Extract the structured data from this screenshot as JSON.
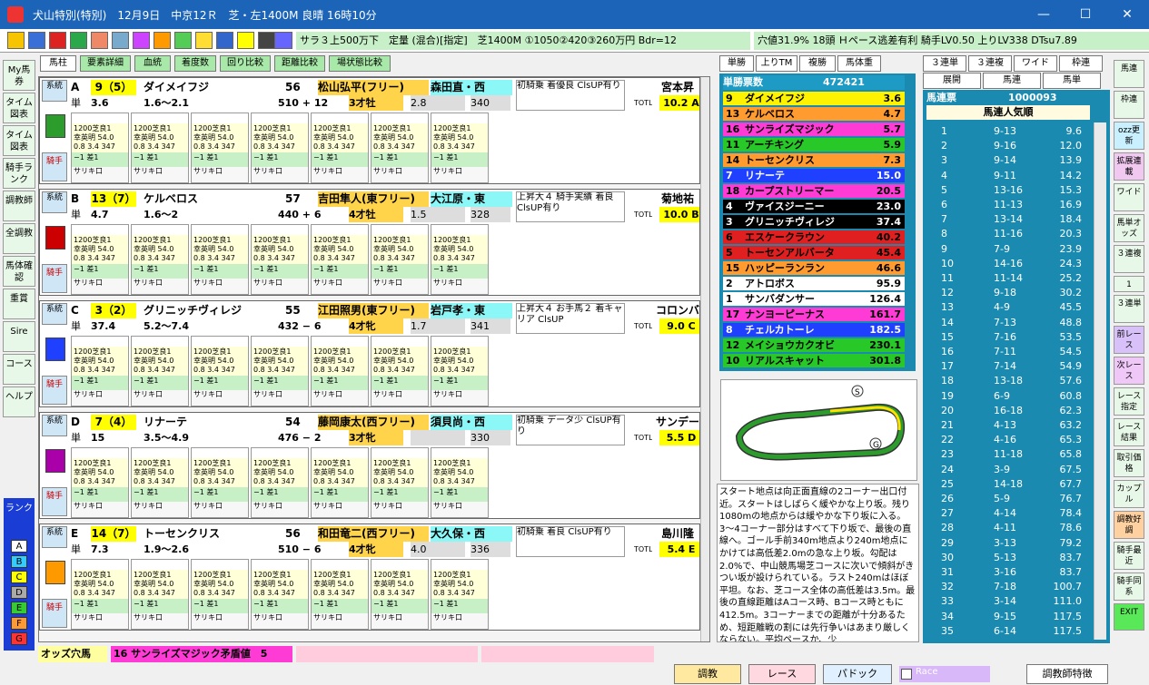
{
  "window": {
    "title": "犬山特別(特別)　12月9日　中京12Ｒ　芝・左1400M 良晴 16時10分",
    "minimize": "—",
    "maximize": "☐",
    "close": "✕"
  },
  "toolbar": {
    "race_info": "サラ３上500万下　定量 (混合)[指定]　芝1400M ①1050②420③260万円 Bdr=12",
    "race_info2": "穴値31.9% 18頭 Ｈペース逃差有利 騎手LV0.50 上りLV338 DTsu7.89"
  },
  "leftnav": [
    "My馬券",
    "タイム図表",
    "タイム図表",
    "騎手ランク",
    "調教師",
    "全調教",
    "馬体確認",
    "重賞",
    "Sire",
    "コース",
    "ヘルプ"
  ],
  "rank": {
    "title": "ランク",
    "levels": [
      "A",
      "B",
      "C",
      "D",
      "E",
      "F",
      "G"
    ]
  },
  "tabs": [
    "馬柱",
    "要素詳細",
    "血統",
    "着度数",
    "回り比較",
    "距離比較",
    "場状態比較"
  ],
  "horses": [
    {
      "tag": "A",
      "num": "9（5）",
      "name": "ダイメイフジ",
      "wt": "56",
      "jockey": "松山弘平(フリー)",
      "trainer": "森田直・西",
      "comment": "初騎乗 着優良 ClsUP有り",
      "owner": "宮本昇",
      "odds": "3.6",
      "oddsrange": "1.6〜2.1",
      "bw": "510 + 12",
      "age": "3才牡",
      "pos": "2.8",
      "agari": "340",
      "totl": "10.2 A",
      "sel": "系統",
      "btm": "騎手"
    },
    {
      "tag": "B",
      "num": "13（7）",
      "name": "ケルベロス",
      "wt": "57",
      "jockey": "吉田隼人(東フリー)",
      "trainer": "大江原・東",
      "comment": "上昇大４ 騎手実績 着良ClsUP有り",
      "owner": "菊地祐",
      "odds": "4.7",
      "oddsrange": "1.6〜2",
      "bw": "440 + 6",
      "age": "4才牡",
      "pos": "1.5",
      "agari": "328",
      "totl": "10.0 B",
      "sel": "系統",
      "btm": "騎手"
    },
    {
      "tag": "C",
      "num": "3（2）",
      "name": "グリニッチヴィレジ",
      "wt": "55",
      "jockey": "江田照男(東フリー)",
      "trainer": "岩戸孝・東",
      "comment": "上昇大４ お手馬２ 着キャリア ClsUP",
      "owner": "コロンバ",
      "odds": "37.4",
      "oddsrange": "5.2〜7.4",
      "bw": "432 − 6",
      "age": "4才牝",
      "pos": "1.7",
      "agari": "341",
      "totl": "9.0 C",
      "sel": "系統",
      "btm": "騎手"
    },
    {
      "tag": "D",
      "num": "7（4）",
      "name": "リナーテ",
      "wt": "54",
      "jockey": "藤岡康太(西フリー)",
      "trainer": "須貝尚・西",
      "comment": "初騎乗 データ少 ClsUP有り",
      "owner": "サンデー",
      "odds": "15",
      "oddsrange": "3.5〜4.9",
      "bw": "476 − 2",
      "age": "3才牝",
      "pos": "",
      "agari": "330",
      "totl": "5.5 D",
      "sel": "系統",
      "btm": "騎手"
    },
    {
      "tag": "E",
      "num": "14（7）",
      "name": "トーセンクリス",
      "wt": "56",
      "jockey": "和田竜二(西フリー)",
      "trainer": "大久保・西",
      "comment": "初騎乗 着良 ClsUP有り",
      "owner": "島川隆",
      "odds": "7.3",
      "oddsrange": "1.9〜2.6",
      "bw": "510 − 6",
      "age": "4才牝",
      "pos": "4.0",
      "agari": "336",
      "totl": "5.4 E",
      "sel": "系統",
      "btm": "騎手"
    }
  ],
  "past": {
    "race": "1200芝良1",
    "jockey": "幸英明 54.0",
    "stats": "0.8 3.4 347",
    "res": "−1 差1",
    "horse": "サリキ口",
    "time": "518 1:10:4"
  },
  "oddsbar": {
    "label": "オッズ穴馬",
    "value": "16 サンライズマジック矛盾値　5"
  },
  "tan": {
    "tabs": [
      "単勝",
      "上りTM",
      "複勝",
      "馬体重"
    ],
    "header": "単勝票数",
    "votes": "472421",
    "rows": [
      {
        "n": "9",
        "name": "ダイメイフジ",
        "o": "3.6",
        "bg": "#fff200",
        "fg": "#000"
      },
      {
        "n": "13",
        "name": "ケルベロス",
        "o": "4.7",
        "bg": "#ff9b2f",
        "fg": "#000"
      },
      {
        "n": "16",
        "name": "サンライズマジック",
        "o": "5.7",
        "bg": "#ff3bd6",
        "fg": "#000"
      },
      {
        "n": "11",
        "name": "アーチキング",
        "o": "5.9",
        "bg": "#28c828",
        "fg": "#000"
      },
      {
        "n": "14",
        "name": "トーセンクリス",
        "o": "7.3",
        "bg": "#ff9b2f",
        "fg": "#000"
      },
      {
        "n": "7",
        "name": "リナーテ",
        "o": "15.0",
        "bg": "#2040ff",
        "fg": "#fff"
      },
      {
        "n": "18",
        "name": "カープストリーマー",
        "o": "20.5",
        "bg": "#ff3bd6",
        "fg": "#000"
      },
      {
        "n": "4",
        "name": "ヴァイスジーニー",
        "o": "23.0",
        "bg": "#000",
        "fg": "#fff"
      },
      {
        "n": "3",
        "name": "グリニッチヴィレジ",
        "o": "37.4",
        "bg": "#000",
        "fg": "#fff"
      },
      {
        "n": "6",
        "name": "エスケークラウン",
        "o": "40.2",
        "bg": "#e02020",
        "fg": "#000"
      },
      {
        "n": "5",
        "name": "トーセンアルバータ",
        "o": "45.4",
        "bg": "#e02020",
        "fg": "#000"
      },
      {
        "n": "15",
        "name": "ハッピーランラン",
        "o": "46.6",
        "bg": "#ff9b2f",
        "fg": "#000"
      },
      {
        "n": "2",
        "name": "アトロボス",
        "o": "95.9",
        "bg": "#fff",
        "fg": "#000"
      },
      {
        "n": "1",
        "name": "サンバダンサー",
        "o": "126.4",
        "bg": "#fff",
        "fg": "#000"
      },
      {
        "n": "17",
        "name": "ナンヨーピーナス",
        "o": "161.7",
        "bg": "#ff3bd6",
        "fg": "#000"
      },
      {
        "n": "8",
        "name": "チェルカトーレ",
        "o": "182.5",
        "bg": "#2040ff",
        "fg": "#fff"
      },
      {
        "n": "12",
        "name": "メイショウカクオビ",
        "o": "230.1",
        "bg": "#28c828",
        "fg": "#000"
      },
      {
        "n": "10",
        "name": "リアルスキャット",
        "o": "301.8",
        "bg": "#28c828",
        "fg": "#000"
      }
    ]
  },
  "desc": "スタート地点は向正面直線の2コーナー出口付近。スタートはしばらく緩やかな上り坂。残り1080mの地点からは緩やかな下り坂に入る。3〜4コーナー部分はすべて下り坂で、最後の直線へ。ゴール手前340m地点より240m地点にかけては高低差2.0mの急な上り坂。勾配は2.0%で、中山競馬場芝コースに次いで傾斜がきつい坂が設けられている。ラスト240mはほぼ平坦。なお、芝コース全体の高低差は3.5m。最後の直線距離はAコース時、Bコース時ともに412.5m。3コーナーまでの距離が十分あるため、短距離戦の割には先行争いはあまり厳しくならない。平均ペースか、少",
  "rtabs": [
    "３連単",
    "３連複",
    "ワイド",
    "枠連",
    "展開",
    "馬連",
    "馬単"
  ],
  "baren": {
    "title": "馬連票",
    "votes": "1000093",
    "sub": "馬連人気順",
    "rows": [
      [
        "1",
        "9-13",
        "9.6"
      ],
      [
        "2",
        "9-16",
        "12.0"
      ],
      [
        "3",
        "9-14",
        "13.9"
      ],
      [
        "4",
        "9-11",
        "14.2"
      ],
      [
        "5",
        "13-16",
        "15.3"
      ],
      [
        "6",
        "11-13",
        "16.9"
      ],
      [
        "7",
        "13-14",
        "18.4"
      ],
      [
        "8",
        "11-16",
        "20.3"
      ],
      [
        "9",
        "7-9",
        "23.9"
      ],
      [
        "10",
        "14-16",
        "24.3"
      ],
      [
        "11",
        "11-14",
        "25.2"
      ],
      [
        "12",
        "9-18",
        "30.2"
      ],
      [
        "13",
        "4-9",
        "45.5"
      ],
      [
        "14",
        "7-13",
        "48.8"
      ],
      [
        "15",
        "7-16",
        "53.5"
      ],
      [
        "16",
        "7-11",
        "54.5"
      ],
      [
        "17",
        "7-14",
        "54.9"
      ],
      [
        "18",
        "13-18",
        "57.6"
      ],
      [
        "19",
        "6-9",
        "60.8"
      ],
      [
        "20",
        "16-18",
        "62.3"
      ],
      [
        "21",
        "4-13",
        "63.2"
      ],
      [
        "22",
        "4-16",
        "65.3"
      ],
      [
        "23",
        "11-18",
        "65.8"
      ],
      [
        "24",
        "3-9",
        "67.5"
      ],
      [
        "25",
        "14-18",
        "67.7"
      ],
      [
        "26",
        "5-9",
        "76.7"
      ],
      [
        "27",
        "4-14",
        "78.4"
      ],
      [
        "28",
        "4-11",
        "78.6"
      ],
      [
        "29",
        "3-13",
        "79.2"
      ],
      [
        "30",
        "5-13",
        "83.7"
      ],
      [
        "31",
        "3-16",
        "83.7"
      ],
      [
        "32",
        "7-18",
        "100.7"
      ],
      [
        "33",
        "3-14",
        "111.0"
      ],
      [
        "34",
        "9-15",
        "117.5"
      ],
      [
        "35",
        "6-14",
        "117.5"
      ]
    ]
  },
  "farnav": [
    "馬連",
    "枠連",
    "ozz更新",
    "拡展連載",
    "ワイド",
    "馬単オッズ",
    "３連複",
    "1",
    "３連単",
    "前レース",
    "次レース",
    "レース指定",
    "レース結果",
    "取引価格",
    "カップル",
    "調教好調",
    "騎手最近",
    "騎手同系",
    "EXIT"
  ],
  "bottom": {
    "b1": "調教",
    "b2": "レース",
    "b3": "パドック",
    "race": "Race",
    "b4": "調教師特徴"
  }
}
